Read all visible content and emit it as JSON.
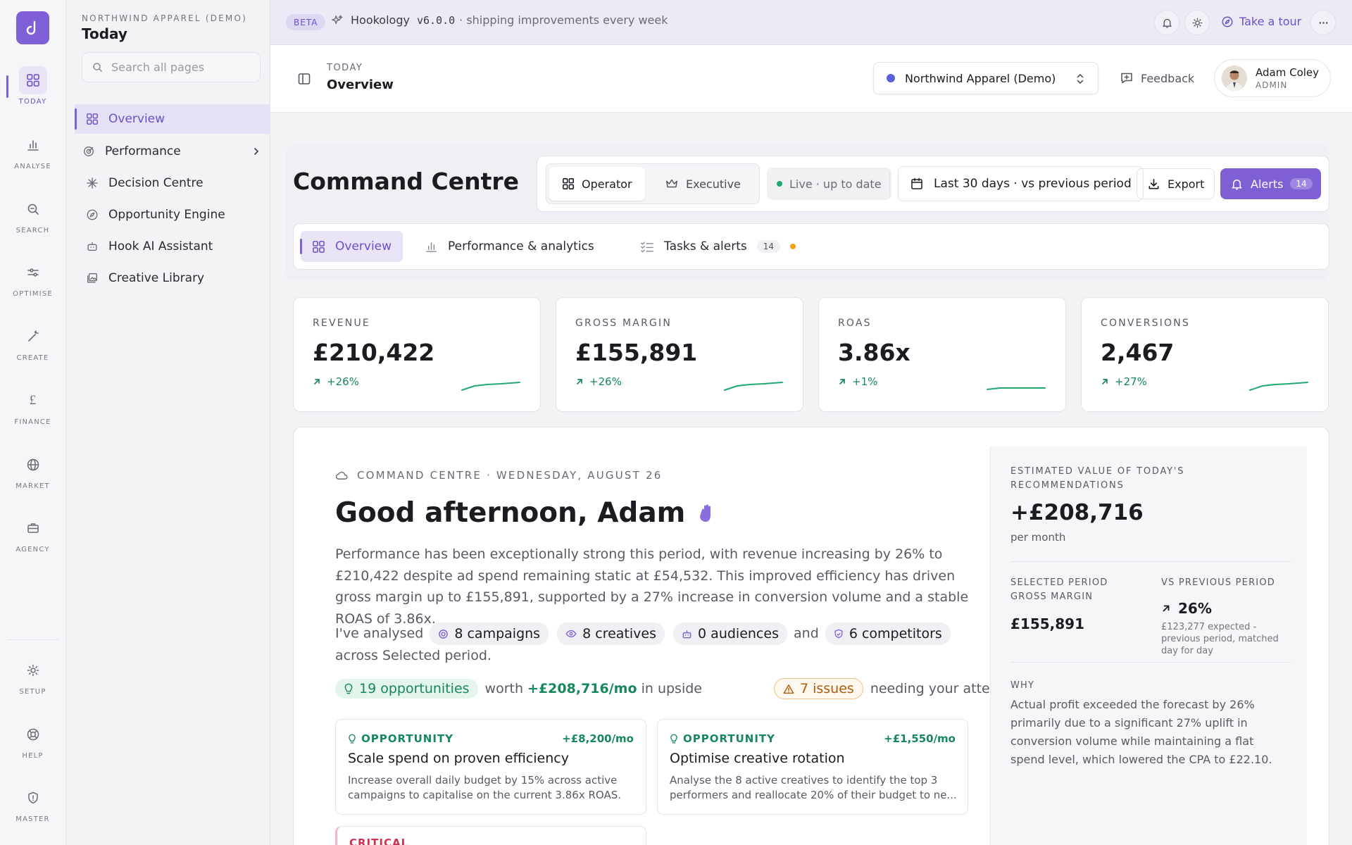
{
  "brand": {
    "accent": "#7f60d6",
    "positive": "#17875c",
    "warning": "#b05a0c",
    "critical": "#d1334f"
  },
  "rail": {
    "logo_icon": "hook-logo-icon",
    "items": [
      {
        "label": "TODAY",
        "icon": "grid-icon",
        "active": true
      },
      {
        "label": "ANALYSE",
        "icon": "bar-chart-icon"
      },
      {
        "label": "SEARCH",
        "icon": "search-icon"
      },
      {
        "label": "OPTIMISE",
        "icon": "sliders-icon"
      },
      {
        "label": "CREATE",
        "icon": "magic-wand-icon"
      },
      {
        "label": "FINANCE",
        "icon": "pound-icon"
      },
      {
        "label": "MARKET",
        "icon": "globe-icon"
      },
      {
        "label": "AGENCY",
        "icon": "briefcase-icon"
      },
      {
        "label": "SETUP",
        "icon": "sun-gear-icon"
      },
      {
        "label": "HELP",
        "icon": "lifebuoy-icon"
      },
      {
        "label": "MASTER",
        "icon": "shield-icon"
      }
    ]
  },
  "sidebar": {
    "org": "NORTHWIND APPAREL (DEMO)",
    "title": "Today",
    "search_placeholder": "Search all pages",
    "items": [
      {
        "label": "Overview",
        "icon": "grid-icon",
        "active": true
      },
      {
        "label": "Performance",
        "icon": "target-icon",
        "expandable": true
      },
      {
        "label": "Decision Centre",
        "icon": "spark-icon"
      },
      {
        "label": "Opportunity Engine",
        "icon": "compass-icon"
      },
      {
        "label": "Hook AI Assistant",
        "icon": "bot-icon"
      },
      {
        "label": "Creative Library",
        "icon": "images-icon"
      }
    ]
  },
  "topbar": {
    "badge": "BETA",
    "product": "Hookology",
    "version": "v6.0.0",
    "tagline": "· shipping improvements every week",
    "tour": "Take a tour"
  },
  "header": {
    "crumb": "TODAY",
    "title": "Overview",
    "org_select": "Northwind Apparel (Demo)",
    "feedback": "Feedback",
    "user_name": "Adam Coley",
    "user_role": "ADMIN"
  },
  "command": {
    "title": "Command Centre",
    "modes": [
      "Operator",
      "Executive"
    ],
    "live": "Live · up to date",
    "date_range": "Last 30 days · vs previous period",
    "export": "Export",
    "alerts": "Alerts",
    "alerts_count": "14"
  },
  "tabs": [
    {
      "label": "Overview",
      "active": true
    },
    {
      "label": "Performance & analytics"
    },
    {
      "label": "Tasks & alerts",
      "badge": "14"
    }
  ],
  "kpis": [
    {
      "label": "REVENUE",
      "value": "£210,422",
      "delta": "+26%"
    },
    {
      "label": "GROSS MARGIN",
      "value": "£155,891",
      "delta": "+26%"
    },
    {
      "label": "ROAS",
      "value": "3.86x",
      "delta": "+1%"
    },
    {
      "label": "CONVERSIONS",
      "value": "2,467",
      "delta": "+27%"
    }
  ],
  "briefing": {
    "crumb": "COMMAND CENTRE · WEDNESDAY, AUGUST 26",
    "greeting": "Good afternoon, Adam",
    "summary": "Performance has been exceptionally strong this period, with revenue increasing by 26% to £210,422 despite ad spend remaining static at £54,532. This improved efficiency has driven gross margin up to £155,891, supported by a 27% increase in conversion volume and a stable ROAS of 3.86x.",
    "analysed_prefix": "I've analysed",
    "chips": [
      "8 campaigns",
      "8 creatives",
      "0 audiences",
      "6 competitors"
    ],
    "and": "and",
    "analysed_suffix": "across Selected period.",
    "opportunities": "19 opportunities",
    "worth_prefix": "worth",
    "worth_value": "+£208,716/mo",
    "worth_suffix": "in upside",
    "issues": "7 issues",
    "issues_suffix": "needing your attention"
  },
  "opportunities": [
    {
      "type": "OPPORTUNITY",
      "value": "+£8,200/mo",
      "title": "Scale spend on proven efficiency",
      "body": "Increase overall daily budget by 15% across active campaigns to capitalise on the current 3.86x ROAS."
    },
    {
      "type": "OPPORTUNITY",
      "value": "+£1,550/mo",
      "title": "Optimise creative rotation",
      "body": "Analyse the 8 active creatives to identify the top 3 performers and reallocate 20% of their budget to ne..."
    }
  ],
  "critical": {
    "type": "CRITICAL"
  },
  "panel": {
    "est_label": "ESTIMATED VALUE OF TODAY'S RECOMMENDATIONS",
    "est_value": "+£208,716",
    "est_unit": "per month",
    "sel_label": "SELECTED PERIOD GROSS MARGIN",
    "sel_value": "£155,891",
    "vs_label": "VS PREVIOUS PERIOD",
    "vs_value": "26%",
    "vs_note": "£123,277 expected - previous period, matched day for day",
    "why_label": "WHY",
    "why_text": "Actual profit exceeded the forecast by 26% primarily due to a significant 27% uplift in conversion volume while maintaining a flat spend level, which lowered the CPA to £22.10."
  }
}
